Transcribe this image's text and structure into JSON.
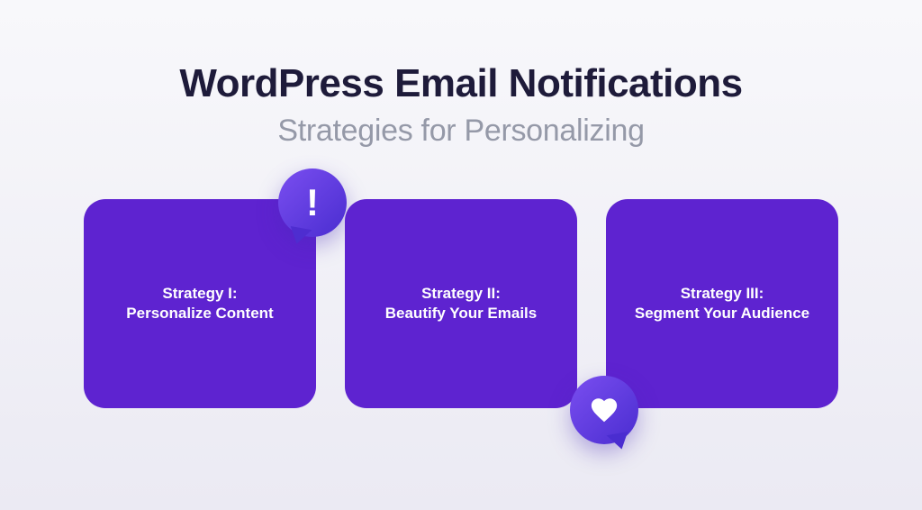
{
  "header": {
    "title": "WordPress Email Notifications",
    "subtitle": "Strategies for Personalizing"
  },
  "cards": [
    {
      "label": "Strategy I:",
      "text": "Personalize Content"
    },
    {
      "label": "Strategy II:",
      "text": "Beautify Your Emails"
    },
    {
      "label": "Strategy III:",
      "text": "Segment Your Audience"
    }
  ],
  "colors": {
    "card_bg": "#5e23d0",
    "title_color": "#1e1b3a",
    "subtitle_color": "#9599a8"
  }
}
